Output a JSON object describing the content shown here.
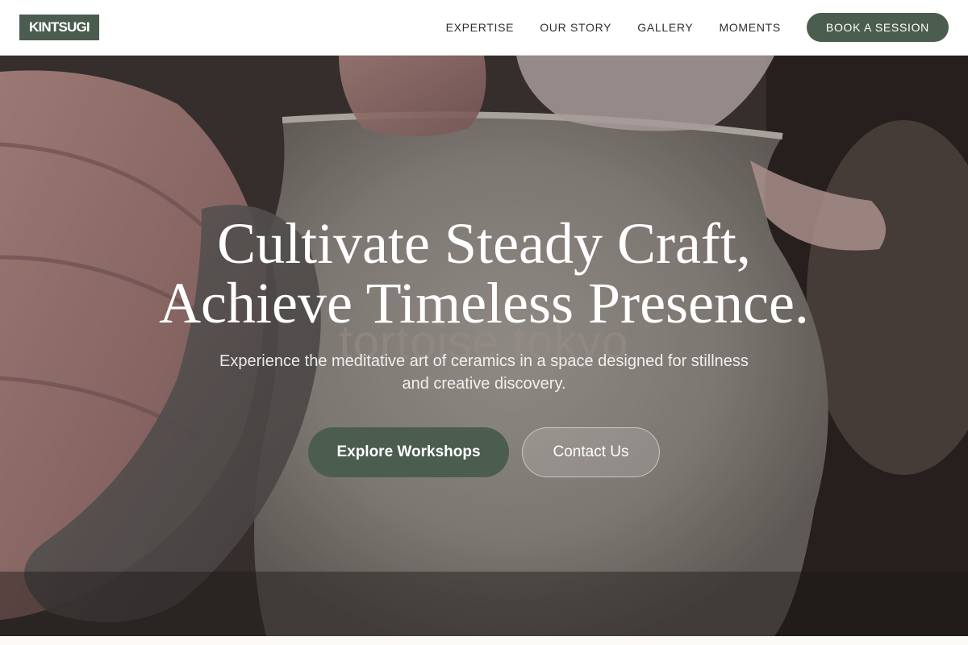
{
  "header": {
    "logo": "KINTSUGI",
    "nav": [
      "EXPERTISE",
      "OUR STORY",
      "GALLERY",
      "MOMENTS"
    ],
    "cta": "BOOK A SESSION"
  },
  "hero": {
    "headline_line1": "Cultivate Steady Craft,",
    "headline_line2": "Achieve Timeless Presence.",
    "subtext_line1": "Experience the meditative art of ceramics in a space designed for stillness",
    "subtext_line2": "and creative discovery.",
    "watermark": "tortoise tokyo",
    "primary_button": "Explore Workshops",
    "secondary_button": "Contact Us"
  },
  "colors": {
    "accent": "#4b5d4e",
    "header_bg": "#ffffff",
    "page_bg": "#fbfaf6"
  }
}
